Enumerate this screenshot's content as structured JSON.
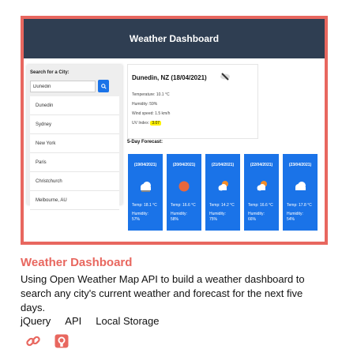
{
  "app": {
    "title": "Weather Dashboard",
    "search_label": "Search for a City:",
    "search_value": "Dunedin",
    "cities": [
      "Dunedin",
      "Sydney",
      "New York",
      "Paris",
      "Christchurch",
      "Melbourne, AU"
    ],
    "current": {
      "title": "Dunedin, NZ (18/04/2021)",
      "icon": "cloud-wind-icon",
      "temperature": "Temperature: 10.1 °C",
      "humidity": "Humidity: 59%",
      "wind": "Wind speed: 1.5 km/h",
      "uv_label": "UV Index:",
      "uv_value": "3.07"
    },
    "forecast_title": "5-Day Forecast:",
    "forecast": [
      {
        "date": "(19/04/2021)",
        "icon": "cloud-icon",
        "temp": "Temp: 18.1 °C",
        "humidity_label": "Humidity:",
        "humidity": "57%"
      },
      {
        "date": "(20/04/2021)",
        "icon": "sun-icon",
        "temp": "Temp: 16.6 °C",
        "humidity_label": "Humidity:",
        "humidity": "58%"
      },
      {
        "date": "(21/04/2021)",
        "icon": "partly-cloudy-icon",
        "temp": "Temp: 14.2 °C",
        "humidity_label": "Humidity:",
        "humidity": "75%"
      },
      {
        "date": "(22/04/2021)",
        "icon": "partly-cloudy-icon",
        "temp": "Temp: 16.6 °C",
        "humidity_label": "Humidity:",
        "humidity": "66%"
      },
      {
        "date": "(23/04/2021)",
        "icon": "cloud-icon",
        "temp": "Temp: 17.8 °C",
        "humidity_label": "Humidity:",
        "humidity": "54%"
      }
    ]
  },
  "project": {
    "title": "Weather Dashboard",
    "description": "Using Open Weather Map API to build a weather dashboard to search any city's current weather and forecast for the next five days.",
    "tags": [
      "jQuery",
      "API",
      "Local Storage"
    ],
    "links": [
      {
        "icon": "link-icon"
      },
      {
        "icon": "github-icon"
      }
    ]
  },
  "colors": {
    "accent": "#e8675f",
    "header": "#2f3e52",
    "card": "#1a73e8",
    "uv_highlight": "#fff200"
  }
}
